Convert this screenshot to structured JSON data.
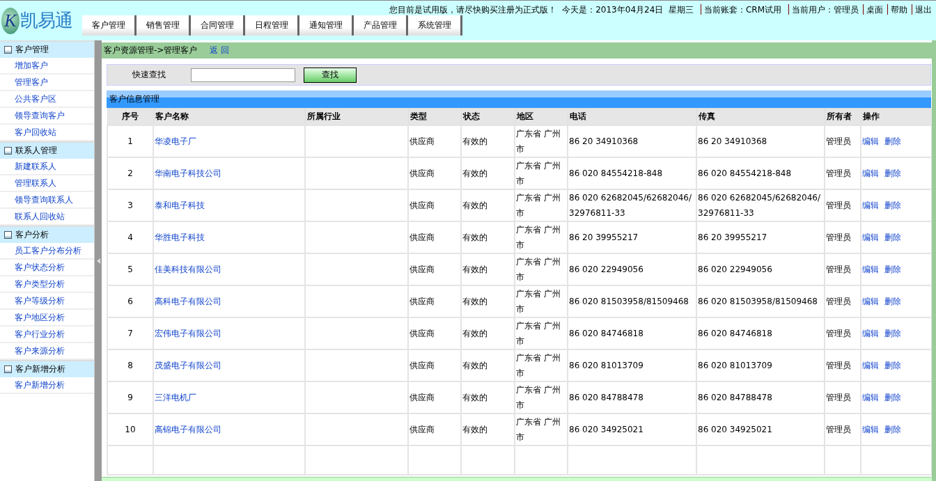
{
  "logo": {
    "mark": "K",
    "name": "凯易通"
  },
  "top_info": {
    "notice": "您目前是试用版，请尽快购买注册为正式版！",
    "today": "今天是：2013年04月24日  星期三",
    "account": "当前账套：CRM试用",
    "user": "当前用户：管理员",
    "links": [
      "桌面",
      "帮助",
      "退出"
    ]
  },
  "tabs": [
    "客户管理",
    "销售管理",
    "合同管理",
    "日程管理",
    "通知管理",
    "产品管理",
    "系统管理"
  ],
  "sidebar": {
    "sections": [
      {
        "title": "客户管理",
        "items": [
          "增加客户",
          "管理客户",
          "公共客户区",
          "领导查询客户",
          "客户回收站"
        ]
      },
      {
        "title": "联系人管理",
        "items": [
          "新建联系人",
          "管理联系人",
          "领导查询联系人",
          "联系人回收站"
        ]
      },
      {
        "title": "客户分析",
        "items": [
          "员工客户分布分析",
          "客户状态分析",
          "客户类型分析",
          "客户等级分析",
          "客户地区分析",
          "客户行业分析",
          "客户来源分析"
        ]
      },
      {
        "title": "客户新增分析",
        "items": [
          "客户新增分析"
        ]
      }
    ]
  },
  "breadcrumb": {
    "path": "客户资源管理->管理客户",
    "back": "返 回"
  },
  "search": {
    "label": "快速查找",
    "button": "查找"
  },
  "table": {
    "title": "客户信息管理",
    "columns": [
      "序号",
      "客户名称",
      "所属行业",
      "类型",
      "状态",
      "地区",
      "电话",
      "传真",
      "所有者",
      "操作"
    ],
    "rows": [
      {
        "index": "1",
        "name": "华凌电子厂",
        "type": "供应商",
        "status": "有效的",
        "region": "广东省 广州市",
        "phone": "86 20 34910368",
        "fax": "86 20 34910368",
        "owner": "管理员",
        "actions": [
          "编辑",
          "删除"
        ]
      },
      {
        "index": "2",
        "name": "华南电子科技公司",
        "type": "供应商",
        "status": "有效的",
        "region": "广东省 广州市",
        "phone": "86 020 84554218-848",
        "fax": "86 020 84554218-848",
        "owner": "管理员",
        "actions": [
          "编辑",
          "删除"
        ]
      },
      {
        "index": "3",
        "name": "泰和电子科技",
        "type": "供应商",
        "status": "有效的",
        "region": "广东省 广州市",
        "phone": "86 020 62682045/62682046/32976811-33",
        "fax": "86 020 62682045/62682046/32976811-33",
        "owner": "管理员",
        "actions": [
          "编辑",
          "删除"
        ]
      },
      {
        "index": "4",
        "name": "华胜电子科技",
        "type": "供应商",
        "status": "有效的",
        "region": "广东省 广州市",
        "phone": "86 20 39955217",
        "fax": "86 20 39955217",
        "owner": "管理员",
        "actions": [
          "编辑",
          "删除"
        ]
      },
      {
        "index": "5",
        "name": "佳美科技有限公司",
        "type": "供应商",
        "status": "有效的",
        "region": "广东省 广州市",
        "phone": "86 020 22949056",
        "fax": "86 020 22949056",
        "owner": "管理员",
        "actions": [
          "编辑",
          "删除"
        ]
      },
      {
        "index": "6",
        "name": "高科电子有限公司",
        "type": "供应商",
        "status": "有效的",
        "region": "广东省 广州市",
        "phone": "86 020 81503958/81509468",
        "fax": "86 020 81503958/81509468",
        "owner": "管理员",
        "actions": [
          "编辑",
          "删除"
        ]
      },
      {
        "index": "7",
        "name": "宏伟电子有限公司",
        "type": "供应商",
        "status": "有效的",
        "region": "广东省 广州市",
        "phone": "86 020 84746818",
        "fax": "86 020 84746818",
        "owner": "管理员",
        "actions": [
          "编辑",
          "删除"
        ]
      },
      {
        "index": "8",
        "name": "茂盛电子有限公司",
        "type": "供应商",
        "status": "有效的",
        "region": "广东省 广州市",
        "phone": "86 020 81013709",
        "fax": "86 020 81013709",
        "owner": "管理员",
        "actions": [
          "编辑",
          "删除"
        ]
      },
      {
        "index": "9",
        "name": "三洋电机厂",
        "type": "供应商",
        "status": "有效的",
        "region": "广东省 广州市",
        "phone": "86 020 84788478",
        "fax": "86 020 84788478",
        "owner": "管理员",
        "actions": [
          "编辑",
          "删除"
        ]
      },
      {
        "index": "10",
        "name": "高锦电子有限公司",
        "type": "供应商",
        "status": "有效的",
        "region": "广东省 广州市",
        "phone": "86 020 34925021",
        "fax": "86 020 34925021",
        "owner": "管理员",
        "actions": [
          "编辑",
          "删除"
        ]
      }
    ]
  }
}
